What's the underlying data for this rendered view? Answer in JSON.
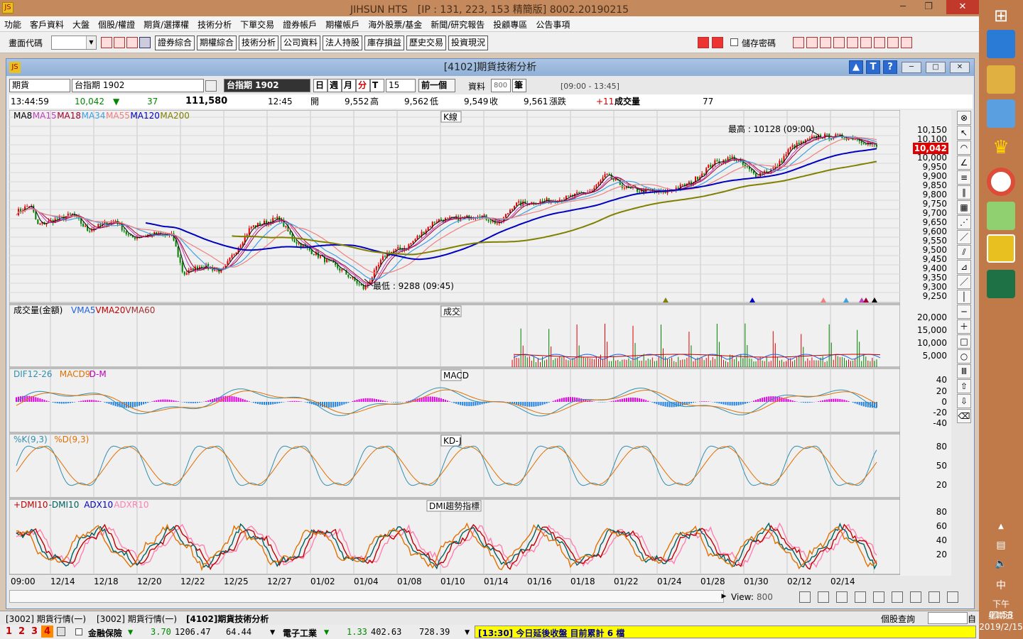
{
  "window": {
    "title": "JIHSUN HTS　[IP : 131, 223, 153 精簡版] 8002.20190215",
    "logo": "JS"
  },
  "menu": [
    "功能",
    "客戶資料",
    "大盤",
    "個股/權證",
    "期貨/選擇權",
    "技術分析",
    "下單交易",
    "證券帳戶",
    "期權帳戶",
    "海外股票/基金",
    "新聞/研究報告",
    "投顧專區",
    "公告事項"
  ],
  "toolbar": {
    "code_label": "畫面代碼",
    "buttons": [
      "證券綜合",
      "期權綜合",
      "技術分析",
      "公司資料",
      "法人持股",
      "庫存損益",
      "歷史交易",
      "投資現況"
    ],
    "save_pwd": "儲存密碼"
  },
  "chartwin": {
    "title": "[4102]期貨技術分析",
    "btn_up": "▲",
    "btn_t": "T",
    "btn_help": "?",
    "logo": "JS"
  },
  "ctrl": {
    "market": "期貨",
    "symbol": "台指期 1902",
    "name": "台指期 1902",
    "periods": [
      "日",
      "週",
      "月",
      "分",
      "T"
    ],
    "interval": "15",
    "prev": "前一個",
    "data_label": "資料",
    "data_count": "800",
    "unit": "筆",
    "session": "[09:00 - 13:45]"
  },
  "quote": {
    "time": "13:44:59",
    "price": "10,042",
    "arrow": "▼",
    "change": "37",
    "volume": "111,580",
    "bar_time": "12:45",
    "open_l": "開",
    "open": "9,552",
    "high_l": "高",
    "high": "9,562",
    "low_l": "低",
    "low": "9,549",
    "close_l": "收",
    "close": "9,561",
    "chg_l": "漲跌",
    "chg": "+11",
    "vol_l": "成交量",
    "vol": "77"
  },
  "panels": {
    "k": {
      "title": "K線",
      "legend": [
        "MA8",
        "MA15",
        "MA18",
        "MA34",
        "MA55",
        "MA120",
        "MA200"
      ],
      "high_note": "最高 : 10128 (09:00)",
      "low_note": "最低 : 9288 (09:45)",
      "last": "10,042",
      "ticks": [
        "10,150",
        "10,100",
        "10,050",
        "10,000",
        "9,950",
        "9,900",
        "9,850",
        "9,800",
        "9,750",
        "9,700",
        "9,650",
        "9,600",
        "9,550",
        "9,500",
        "9,450",
        "9,400",
        "9,350",
        "9,300",
        "9,250"
      ]
    },
    "vol": {
      "title": "成交",
      "legend": [
        "成交量(金額)",
        "VMA5",
        "VMA20",
        "VMA60"
      ],
      "ticks": [
        "20,000",
        "15,000",
        "10,000",
        "5,000"
      ]
    },
    "macd": {
      "title": "MACD",
      "legend": [
        "DIF12-26",
        "MACD9",
        "D-M"
      ],
      "ticks": [
        "40",
        "20",
        "0",
        "-20",
        "-40"
      ]
    },
    "kd": {
      "title": "KD-J",
      "legend": [
        "%K(9,3)",
        "%D(9,3)"
      ],
      "ticks": [
        "80",
        "50",
        "20"
      ]
    },
    "dmi": {
      "title": "DMI趨勢指標",
      "legend": [
        "+DMI10",
        "-DMI10",
        "ADX10",
        "ADXR10"
      ],
      "ticks": [
        "80",
        "60",
        "40",
        "20"
      ]
    }
  },
  "colors": {
    "ma8": "#000000",
    "ma15": "#c040c0",
    "ma18": "#a00030",
    "ma34": "#40a0e0",
    "ma55": "#f08080",
    "ma120": "#0000c0",
    "ma200": "#808000",
    "up": "#e00000",
    "down": "#008000"
  },
  "dates": [
    "09:00",
    "12/14",
    "12/18",
    "12/20",
    "12/22",
    "12/25",
    "12/27",
    "01/02",
    "01/04",
    "01/08",
    "01/10",
    "01/14",
    "01/16",
    "01/18",
    "01/22",
    "01/24",
    "01/28",
    "01/30",
    "02/12",
    "02/14"
  ],
  "footer": {
    "view_label": "View:",
    "view": "800"
  },
  "tabs": [
    "[3002] 期貨行情(一)",
    "[3002] 期貨行情(一)",
    "[4102]期貨技術分析"
  ],
  "tabs_right": {
    "label": "個股查詢",
    "btn": "自"
  },
  "status": {
    "nums": [
      "1",
      "2",
      "3",
      "4"
    ],
    "s1_name": "金融保險",
    "s1_arrow": "▼",
    "s1_chg": "3.70",
    "s1_idx": "1206.47",
    "s1_amt": "64.44",
    "s2_name": "電子工業",
    "s2_arrow": "▼",
    "s2_chg": "1.33",
    "s2_idx": "402.63",
    "s2_amt": "728.39",
    "ticker": "[13:30] 今日延後收盤 目前累計 6 檔"
  },
  "clock": {
    "time": "下午 01:53",
    "day": "星期五",
    "date": "2019/2/15",
    "ime": "中"
  }
}
